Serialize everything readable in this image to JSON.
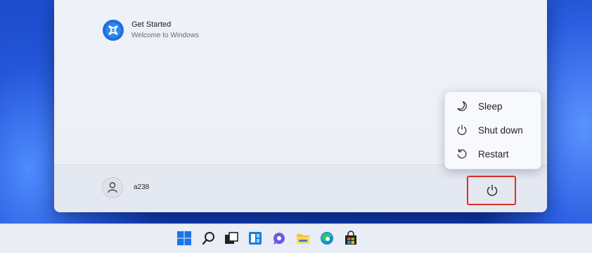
{
  "start_menu": {
    "recommended": {
      "title": "Get Started",
      "subtitle": "Welcome to Windows",
      "icon": "get-started-icon"
    },
    "user": {
      "name": "a238",
      "icon": "person-icon"
    },
    "power_button": {
      "icon": "power-icon"
    }
  },
  "power_menu": {
    "items": [
      {
        "label": "Sleep",
        "icon": "moon-icon"
      },
      {
        "label": "Shut down",
        "icon": "power-icon"
      },
      {
        "label": "Restart",
        "icon": "restart-icon"
      }
    ]
  },
  "taskbar": {
    "icons": [
      "windows-start-icon",
      "search-icon",
      "task-view-icon",
      "widgets-icon",
      "chat-icon",
      "file-explorer-icon",
      "edge-icon",
      "store-icon"
    ]
  },
  "colors": {
    "highlight_border": "#e0302a",
    "accent": "#0f6cbd"
  }
}
